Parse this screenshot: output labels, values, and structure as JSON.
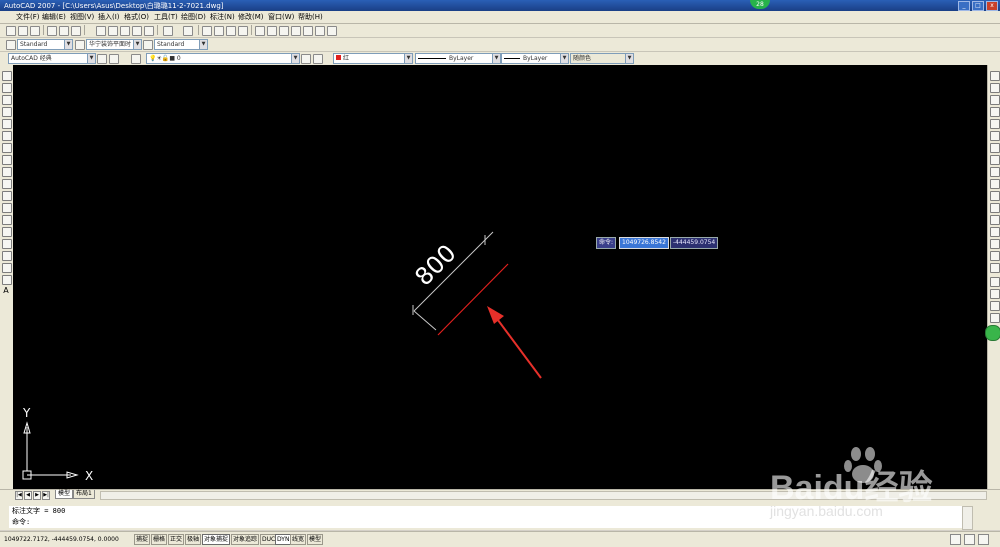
{
  "title_bar": {
    "title": "AutoCAD 2007 - [C:\\Users\\Asus\\Desktop\\白璐璐11-2-7021.dwg]",
    "badge": "28",
    "min": "_",
    "max": "□",
    "close": "x"
  },
  "menu": {
    "items": [
      "文件(F)",
      "编辑(E)",
      "视图(V)",
      "插入(I)",
      "格式(O)",
      "工具(T)",
      "绘图(D)",
      "标注(N)",
      "修改(M)",
      "窗口(W)",
      "帮助(H)"
    ]
  },
  "toolbar_styles": {
    "text_style": "Standard",
    "dim_style": "华宁装饰平面时",
    "table_style": "Standard"
  },
  "toolbar_layers": {
    "workspace": "AutoCAD 经典",
    "layer": "0",
    "color": "红",
    "linetype": "ByLayer",
    "lineweight": "ByLayer",
    "plotstyle": "随颜色"
  },
  "drawing": {
    "dimension_text": "800",
    "ucs_x": "X",
    "ucs_y": "Y"
  },
  "dynamic_input": {
    "label": "命令:",
    "x_value": "1049726.8542",
    "y_value": "-444459.0754"
  },
  "tabs": {
    "model": "模型",
    "layout": "布局1"
  },
  "command": {
    "history": "标注文字 = 800",
    "prompt": "命令:"
  },
  "status_bar": {
    "coords": "1049722.7172, -444459.0754, 0.0000",
    "buttons": [
      "捕捉",
      "栅格",
      "正交",
      "极轴",
      "对象捕捉",
      "对象追踪",
      "DUCS",
      "DYN",
      "线宽",
      "模型"
    ]
  },
  "watermark": {
    "brand": "Baidu经验",
    "url": "jingyan.baidu.com"
  },
  "colors": {
    "canvas": "#000000",
    "dimension_line": "#c8c8c8",
    "red_line": "#e0201e",
    "arrow": "#e6302a",
    "highlight": "#3b76d6"
  }
}
